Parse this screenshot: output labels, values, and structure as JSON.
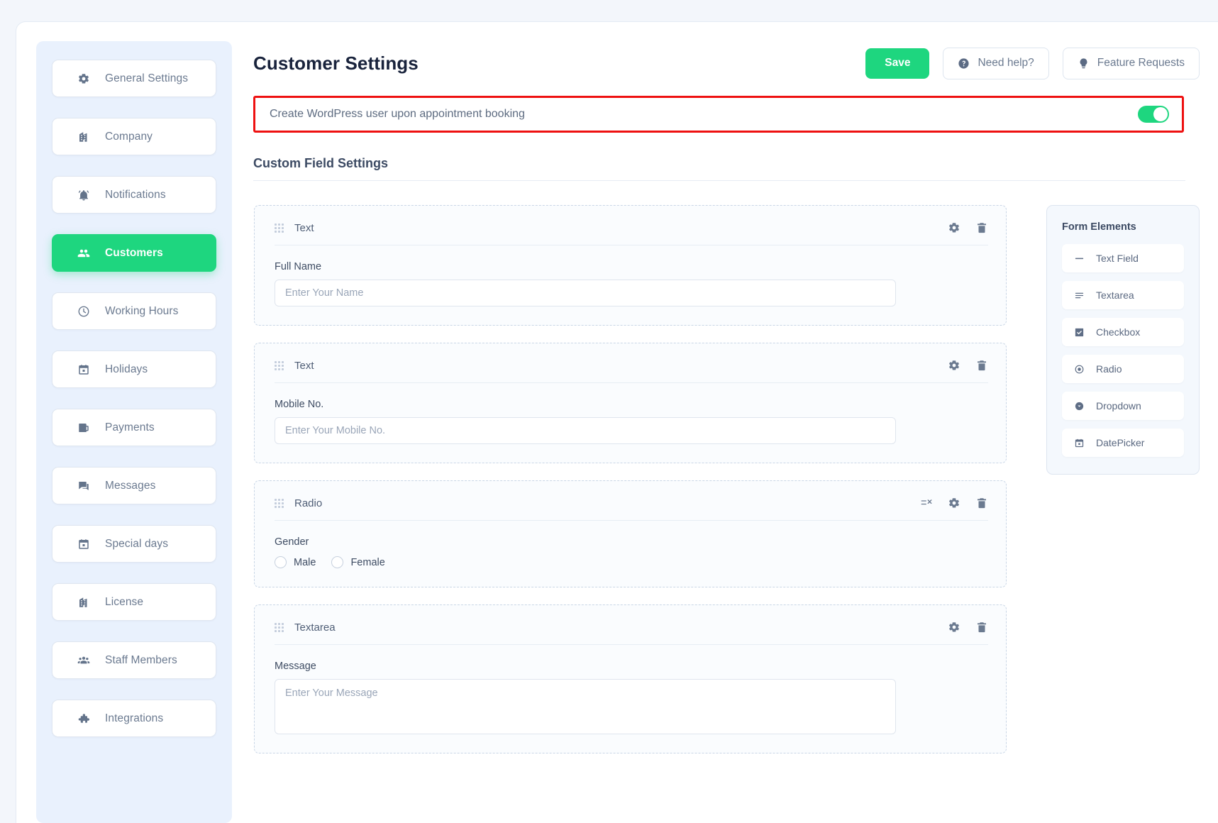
{
  "header": {
    "title": "Customer Settings",
    "save_label": "Save",
    "need_help_label": "Need help?",
    "feature_requests_label": "Feature Requests"
  },
  "wp_user_row": {
    "label": "Create WordPress user upon appointment booking",
    "toggle_state": "on",
    "highlight_color": "#ee1111",
    "accent_color": "#1ed67f"
  },
  "sidebar": {
    "items": [
      {
        "label": "General Settings",
        "icon": "gear-icon",
        "active": false
      },
      {
        "label": "Company",
        "icon": "building-icon",
        "active": false
      },
      {
        "label": "Notifications",
        "icon": "bell-icon",
        "active": false
      },
      {
        "label": "Customers",
        "icon": "people-icon",
        "active": true
      },
      {
        "label": "Working Hours",
        "icon": "clock-icon",
        "active": false
      },
      {
        "label": "Holidays",
        "icon": "calendar-icon",
        "active": false
      },
      {
        "label": "Payments",
        "icon": "wallet-icon",
        "active": false
      },
      {
        "label": "Messages",
        "icon": "chat-icon",
        "active": false
      },
      {
        "label": "Special days",
        "icon": "calendar-icon",
        "active": false
      },
      {
        "label": "License",
        "icon": "building-icon",
        "active": false
      },
      {
        "label": "Staff Members",
        "icon": "group-icon",
        "active": false
      },
      {
        "label": "Integrations",
        "icon": "puzzle-icon",
        "active": false
      }
    ]
  },
  "main": {
    "section_title": "Custom Field Settings",
    "fields": [
      {
        "type": "Text",
        "control": "input",
        "label": "Full Name",
        "placeholder": "Enter Your Name",
        "has_options_action": false
      },
      {
        "type": "Text",
        "control": "input",
        "label": "Mobile No.",
        "placeholder": "Enter Your Mobile No.",
        "has_options_action": false
      },
      {
        "type": "Radio",
        "control": "radio",
        "label": "Gender",
        "options": [
          "Male",
          "Female"
        ],
        "has_options_action": true
      },
      {
        "type": "Textarea",
        "control": "textarea",
        "label": "Message",
        "placeholder": "Enter Your Message",
        "has_options_action": false
      }
    ]
  },
  "form_elements": {
    "title": "Form Elements",
    "items": [
      {
        "label": "Text Field",
        "icon": "text-field-icon"
      },
      {
        "label": "Textarea",
        "icon": "textarea-icon"
      },
      {
        "label": "Checkbox",
        "icon": "checkbox-icon"
      },
      {
        "label": "Radio",
        "icon": "radio-icon"
      },
      {
        "label": "Dropdown",
        "icon": "dropdown-icon"
      },
      {
        "label": "DatePicker",
        "icon": "datepicker-icon"
      }
    ]
  }
}
